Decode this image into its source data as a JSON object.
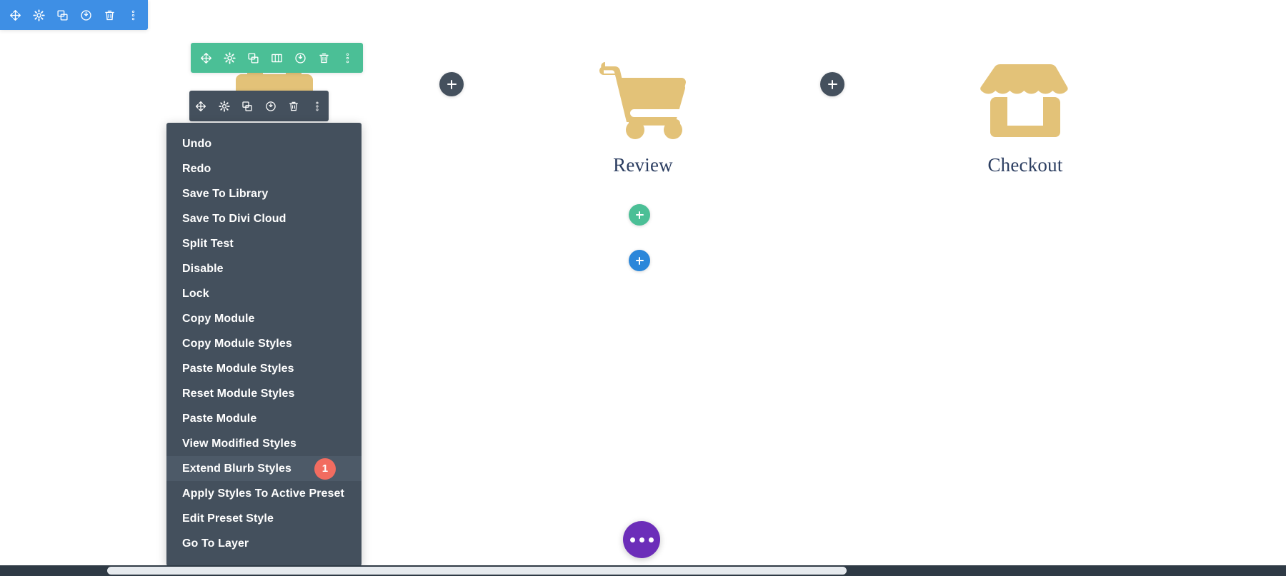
{
  "page_toolbar": {
    "name": "page-settings-toolbar",
    "color": "#3E8FE5",
    "buttons": [
      {
        "icon": "move-icon",
        "label": "Move"
      },
      {
        "icon": "gear-icon",
        "label": "Settings"
      },
      {
        "icon": "duplicate-icon",
        "label": "Duplicate"
      },
      {
        "icon": "power-icon",
        "label": "Disable"
      },
      {
        "icon": "trash-icon",
        "label": "Delete"
      },
      {
        "icon": "kebab-icon",
        "label": "More Options"
      }
    ]
  },
  "section_toolbar": {
    "name": "section-toolbar",
    "color": "#4BBF96",
    "buttons": [
      {
        "icon": "move-icon",
        "label": "Move"
      },
      {
        "icon": "gear-icon",
        "label": "Settings"
      },
      {
        "icon": "duplicate-icon",
        "label": "Duplicate"
      },
      {
        "icon": "columns-icon",
        "label": "Column Structure"
      },
      {
        "icon": "power-icon",
        "label": "Disable"
      },
      {
        "icon": "trash-icon",
        "label": "Delete"
      },
      {
        "icon": "kebab-icon",
        "label": "More Options"
      }
    ]
  },
  "module_toolbar": {
    "name": "module-toolbar",
    "color": "#44505D",
    "buttons": [
      {
        "icon": "move-icon",
        "label": "Move"
      },
      {
        "icon": "gear-icon",
        "label": "Settings"
      },
      {
        "icon": "duplicate-icon",
        "label": "Duplicate"
      },
      {
        "icon": "power-icon",
        "label": "Disable"
      },
      {
        "icon": "trash-icon",
        "label": "Delete"
      },
      {
        "icon": "kebab-icon",
        "label": "More Options"
      }
    ]
  },
  "options_menu": {
    "background": "#44505D",
    "highlight": "#4D5A68",
    "badge_color": "#F26C60",
    "items": [
      {
        "label": "Undo",
        "active": false,
        "badge": null
      },
      {
        "label": "Redo",
        "active": false,
        "badge": null
      },
      {
        "label": "Save To Library",
        "active": false,
        "badge": null
      },
      {
        "label": "Save To Divi Cloud",
        "active": false,
        "badge": null
      },
      {
        "label": "Split Test",
        "active": false,
        "badge": null
      },
      {
        "label": "Disable",
        "active": false,
        "badge": null
      },
      {
        "label": "Lock",
        "active": false,
        "badge": null
      },
      {
        "label": "Copy Module",
        "active": false,
        "badge": null
      },
      {
        "label": "Copy Module Styles",
        "active": false,
        "badge": null
      },
      {
        "label": "Paste Module Styles",
        "active": false,
        "badge": null
      },
      {
        "label": "Reset Module Styles",
        "active": false,
        "badge": null
      },
      {
        "label": "Paste Module",
        "active": false,
        "badge": null
      },
      {
        "label": "View Modified Styles",
        "active": false,
        "badge": null
      },
      {
        "label": "Extend Blurb Styles",
        "active": true,
        "badge": "1"
      },
      {
        "label": "Apply Styles To Active Preset",
        "active": false,
        "badge": null
      },
      {
        "label": "Edit Preset Style",
        "active": false,
        "badge": null
      },
      {
        "label": "Go To Layer",
        "active": false,
        "badge": null
      }
    ]
  },
  "blurbs": [
    {
      "id": "review",
      "title": "Review",
      "icon": "shopping-cart-icon",
      "color": "#E3C278"
    },
    {
      "id": "checkout",
      "title": "Checkout",
      "icon": "storefront-icon",
      "color": "#E3C278"
    }
  ],
  "add_buttons": [
    {
      "id": "add-module-left",
      "icon": "plus-icon",
      "style": "dark",
      "color": "#44505D"
    },
    {
      "id": "add-module-right",
      "icon": "plus-icon",
      "style": "dark",
      "color": "#44505D"
    },
    {
      "id": "add-row-green",
      "icon": "plus-icon",
      "style": "green",
      "color": "#4BBF96"
    },
    {
      "id": "add-row-blue",
      "icon": "plus-icon",
      "style": "blue",
      "color": "#2B87DA"
    }
  ],
  "fab": {
    "id": "builder-settings-fab",
    "icon": "ellipsis-icon",
    "color": "#6C2EB9"
  },
  "scrollbar": {
    "track_color": "#2F3A45",
    "thumb_color": "#E6EAEE"
  }
}
